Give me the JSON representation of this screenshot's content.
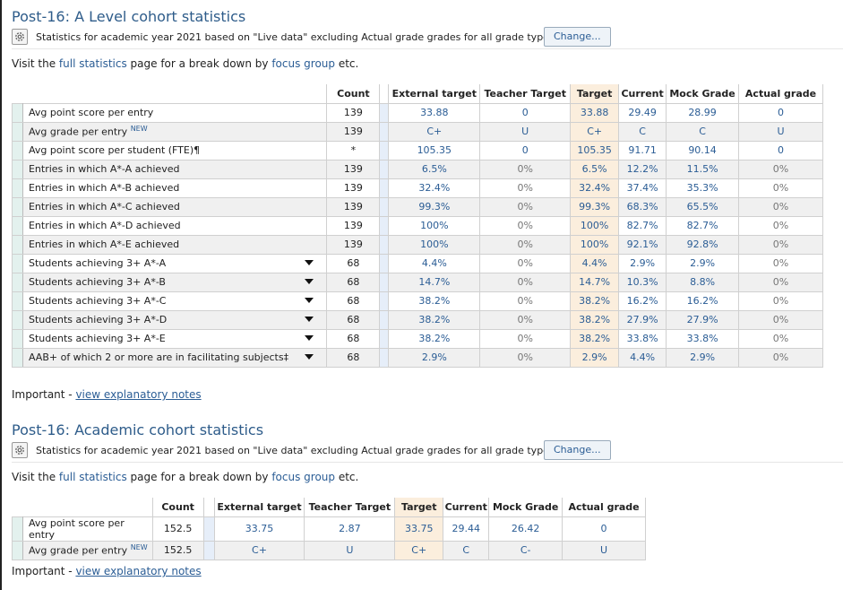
{
  "section1": {
    "title": "Post-16: A Level cohort statistics",
    "stats_text": "Statistics for academic year 2021 based on \"Live data\" excluding Actual grade grades for all grade types.",
    "change_label": "Change...",
    "visit_prefix": "Visit the ",
    "visit_link1": "full statistics",
    "visit_middle": " page for a break down by ",
    "visit_link2": "focus group",
    "visit_suffix": " etc.",
    "headers": [
      "Count",
      "External target",
      "Teacher Target",
      "Target",
      "Current",
      "Mock Grade",
      "Actual grade"
    ],
    "rows": [
      {
        "label": "Avg point score per entry",
        "count": "139",
        "ext": "33.88",
        "teacher": "0",
        "target": "33.88",
        "current": "29.49",
        "mock": "28.99",
        "actual": "0"
      },
      {
        "label": "Avg grade per entry",
        "new": "NEW",
        "count": "139",
        "ext": "C+",
        "teacher": "U",
        "target": "C+",
        "current": "C",
        "mock": "C",
        "actual": "U"
      },
      {
        "label": "Avg point score per student (FTE)¶",
        "count": "*",
        "ext": "105.35",
        "teacher": "0",
        "target": "105.35",
        "current": "91.71",
        "mock": "90.14",
        "actual": "0"
      },
      {
        "label": "Entries in which A*-A achieved",
        "count": "139",
        "ext": "6.5%",
        "teacher": "0%",
        "target": "6.5%",
        "current": "12.2%",
        "mock": "11.5%",
        "actual": "0%"
      },
      {
        "label": "Entries in which A*-B achieved",
        "count": "139",
        "ext": "32.4%",
        "teacher": "0%",
        "target": "32.4%",
        "current": "37.4%",
        "mock": "35.3%",
        "actual": "0%"
      },
      {
        "label": "Entries in which A*-C achieved",
        "count": "139",
        "ext": "99.3%",
        "teacher": "0%",
        "target": "99.3%",
        "current": "68.3%",
        "mock": "65.5%",
        "actual": "0%"
      },
      {
        "label": "Entries in which A*-D achieved",
        "count": "139",
        "ext": "100%",
        "teacher": "0%",
        "target": "100%",
        "current": "82.7%",
        "mock": "82.7%",
        "actual": "0%"
      },
      {
        "label": "Entries in which A*-E achieved",
        "count": "139",
        "ext": "100%",
        "teacher": "0%",
        "target": "100%",
        "current": "92.1%",
        "mock": "92.8%",
        "actual": "0%"
      },
      {
        "label": "Students achieving 3+ A*-A",
        "dropdown": true,
        "count": "68",
        "ext": "4.4%",
        "teacher": "0%",
        "target": "4.4%",
        "current": "2.9%",
        "mock": "2.9%",
        "actual": "0%"
      },
      {
        "label": "Students achieving 3+ A*-B",
        "dropdown": true,
        "count": "68",
        "ext": "14.7%",
        "teacher": "0%",
        "target": "14.7%",
        "current": "10.3%",
        "mock": "8.8%",
        "actual": "0%"
      },
      {
        "label": "Students achieving 3+ A*-C",
        "dropdown": true,
        "count": "68",
        "ext": "38.2%",
        "teacher": "0%",
        "target": "38.2%",
        "current": "16.2%",
        "mock": "16.2%",
        "actual": "0%"
      },
      {
        "label": "Students achieving 3+ A*-D",
        "dropdown": true,
        "count": "68",
        "ext": "38.2%",
        "teacher": "0%",
        "target": "38.2%",
        "current": "27.9%",
        "mock": "27.9%",
        "actual": "0%"
      },
      {
        "label": "Students achieving 3+ A*-E",
        "dropdown": true,
        "count": "68",
        "ext": "38.2%",
        "teacher": "0%",
        "target": "38.2%",
        "current": "33.8%",
        "mock": "33.8%",
        "actual": "0%"
      },
      {
        "label": "AAB+ of which 2 or more are in facilitating subjects‡",
        "dropdown": true,
        "count": "68",
        "ext": "2.9%",
        "teacher": "0%",
        "target": "2.9%",
        "current": "4.4%",
        "mock": "2.9%",
        "actual": "0%"
      }
    ],
    "important_label": "Important - ",
    "important_link": "view explanatory notes"
  },
  "section2": {
    "title": "Post-16: Academic cohort statistics",
    "stats_text": "Statistics for academic year 2021 based on \"Live data\" excluding Actual grade grades for all grade types.",
    "change_label": "Change...",
    "visit_prefix": "Visit the ",
    "visit_link1": "full statistics",
    "visit_middle": " page for a break down by ",
    "visit_link2": "focus group",
    "visit_suffix": " etc.",
    "headers": [
      "Count",
      "External target",
      "Teacher Target",
      "Target",
      "Current",
      "Mock Grade",
      "Actual grade"
    ],
    "rows": [
      {
        "label": "Avg point score per entry",
        "count": "152.5",
        "ext": "33.75",
        "teacher": "2.87",
        "target": "33.75",
        "current": "29.44",
        "mock": "26.42",
        "actual": "0"
      },
      {
        "label": "Avg grade per entry",
        "new": "NEW",
        "count": "152.5",
        "ext": "C+",
        "teacher": "U",
        "target": "C+",
        "current": "C",
        "mock": "C-",
        "actual": "U"
      }
    ],
    "important_label": "Important - ",
    "important_link": "view explanatory notes"
  },
  "icons": {
    "settings": "gear-icon",
    "dropdown": "triangle-down-icon"
  },
  "colors": {
    "link": "#2b5d95",
    "title": "#2e5c8a",
    "target_col": "#fbeedd",
    "stub": "#e3f1ee",
    "separator": "#e6eef9"
  }
}
